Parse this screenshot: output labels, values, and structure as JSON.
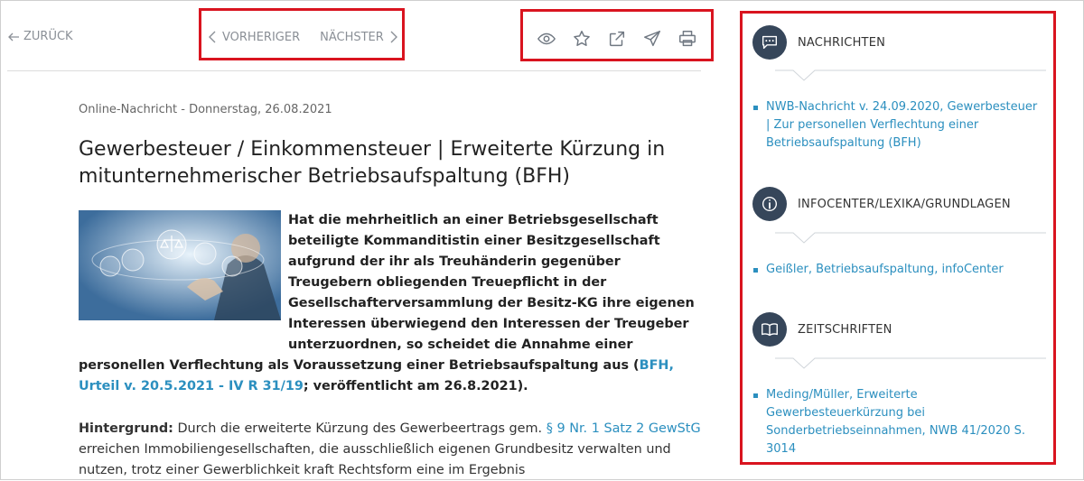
{
  "nav": {
    "back_label": "ZURÜCK",
    "prev_label": "VORHERIGER",
    "next_label": "NÄCHSTER"
  },
  "tools": [
    {
      "icon": "eye-icon"
    },
    {
      "icon": "star-icon"
    },
    {
      "icon": "share-icon"
    },
    {
      "icon": "send-icon"
    },
    {
      "icon": "print-icon"
    }
  ],
  "article": {
    "meta": "Online-Nachricht - Donnerstag, 26.08.2021",
    "title": "Gewerbesteuer / Einkommensteuer | Erweiterte Kürzung in mitunternehmerischer Betriebsaufspaltung (BFH)",
    "lead_text": "Hat die mehrheitlich an einer Betriebsgesellschaft beteiligte Kommanditistin einer Besitzgesellschaft aufgrund der ihr als Treuhänderin gegenüber Treugebern obliegenden Treuepflicht in der Gesellschafterversammlung der Besitz-KG ihre eigenen Interessen überwiegend den Interessen der Treugeber unterzuordnen, so scheidet die Annahme einer personellen Verflechtung als Voraussetzung einer Betriebsaufspaltung aus (",
    "lead_link": "BFH, Urteil v. 20.5.2021 - IV R 31/19",
    "lead_tail": "; veröffentlicht am 26.8.2021).",
    "body_label": "Hintergrund:",
    "body_text_1": " Durch die erweiterte Kürzung des Gewerbeertrags gem. ",
    "body_link": "§ 9 Nr. 1 Satz 2 GewStG",
    "body_text_2": " erreichen Immobiliengesellschaften, die ausschließlich eigenen Grundbesitz verwalten und nutzen, trotz einer Gewerblichkeit kraft Rechtsform eine im Ergebnis"
  },
  "sidebar": {
    "sections": [
      {
        "title": "NACHRICHTEN",
        "icon": "chat-icon",
        "items": [
          "NWB-Nachricht v. 24.09.2020, Gewerbesteuer | Zur personellen Verflechtung einer Betriebsaufspaltung (BFH)"
        ]
      },
      {
        "title": "INFOCENTER/LEXIKA/GRUNDLAGEN",
        "icon": "info-icon",
        "items": [
          "Geißler, Betriebsaufspaltung, infoCenter"
        ]
      },
      {
        "title": "ZEITSCHRIFTEN",
        "icon": "book-icon",
        "items": [
          "Meding/Müller, Erweiterte Gewerbesteuerkürzung bei Sonderbetriebseinnahmen, NWB 41/2020 S. 3014"
        ]
      }
    ]
  },
  "colors": {
    "accent_red": "#d9141f",
    "link_blue": "#2b8fbf",
    "icon_dark": "#36465a"
  }
}
